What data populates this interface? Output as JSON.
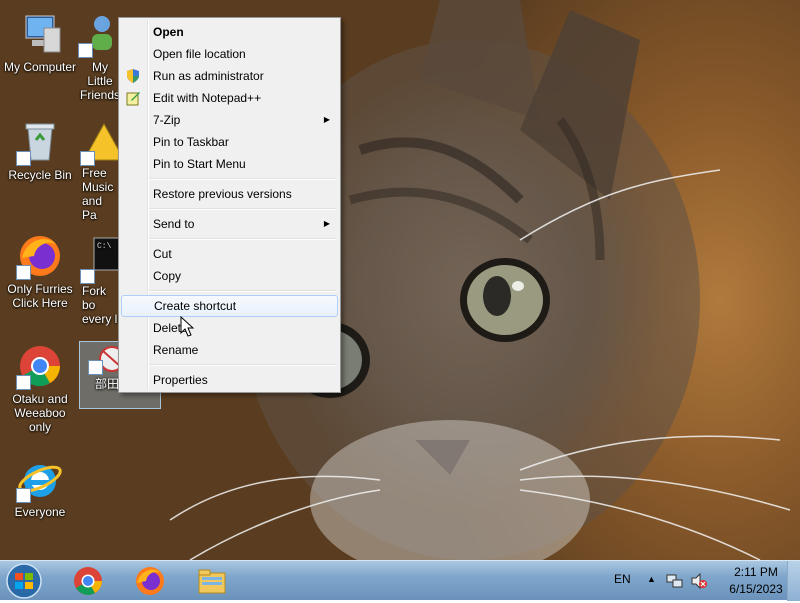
{
  "desktop": {
    "icons": [
      {
        "label": "My Computer"
      },
      {
        "label": "My Little Friends"
      },
      {
        "label": "Recycle Bin"
      },
      {
        "label": "Free Music and Pa"
      },
      {
        "label": "Only Furries Click Here"
      },
      {
        "label": "Fork bo every l"
      },
      {
        "label": "Otaku and Weeaboo only"
      },
      {
        "label": "部田菜径"
      },
      {
        "label": "Everyone"
      }
    ]
  },
  "context_menu": {
    "items": [
      {
        "label": "Open",
        "icon": "none",
        "bold": true
      },
      {
        "label": "Open file location",
        "icon": "none"
      },
      {
        "label": "Run as administrator",
        "icon": "uac-shield-icon"
      },
      {
        "label": "Edit with Notepad++",
        "icon": "notepadpp-icon"
      },
      {
        "label": "7-Zip",
        "submenu": true
      },
      {
        "label": "Pin to Taskbar"
      },
      {
        "label": "Pin to Start Menu"
      },
      {
        "label": "Restore previous versions"
      },
      {
        "label": "Send to",
        "submenu": true
      },
      {
        "label": "Cut"
      },
      {
        "label": "Copy"
      },
      {
        "label": "Create shortcut",
        "state": "hovered"
      },
      {
        "label": "Delete"
      },
      {
        "label": "Rename"
      },
      {
        "label": "Properties"
      }
    ],
    "submenu_arrow": "▶"
  },
  "taskbar": {
    "pinned": [
      "chrome-icon",
      "firefox-icon",
      "file-explorer-icon"
    ],
    "language": "EN",
    "tray_expand": "▲",
    "time": "2:11 PM",
    "date": "6/15/2023"
  },
  "colors": {
    "menu_bg": "#f0f0f0",
    "menu_hover_border": "#aecff7",
    "taskbar": "#7fa6cb"
  }
}
